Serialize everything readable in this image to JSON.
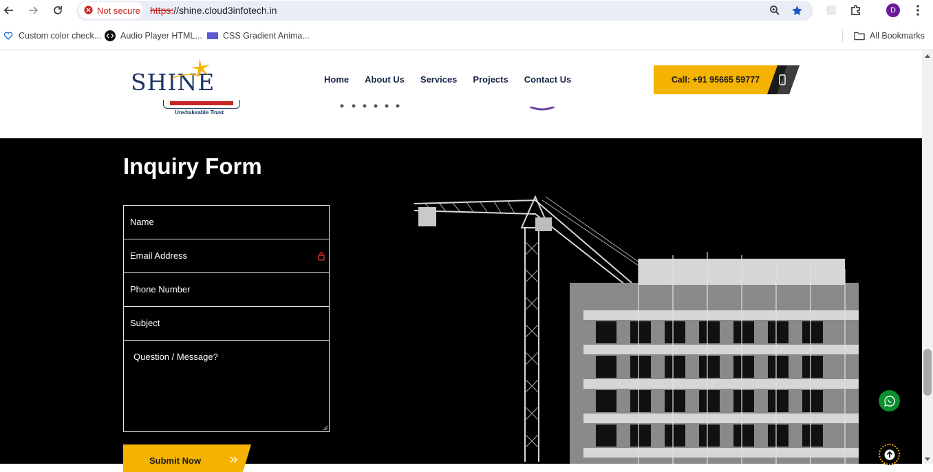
{
  "browser": {
    "security_label": "Not secure",
    "url_scheme": "https:",
    "url_rest": "//shine.cloud3infotech.in",
    "profile_initial": "D"
  },
  "bookmarks": {
    "items": [
      {
        "label": "Custom color check...",
        "icon": "heart-outline-icon"
      },
      {
        "label": "Audio Player HTML...",
        "icon": "code-icon"
      },
      {
        "label": "CSS Gradient Anima...",
        "icon": "gradient-icon"
      }
    ],
    "all_bookmarks": "All Bookmarks"
  },
  "header": {
    "logo_text": "SHINE",
    "nav": [
      "Home",
      "About Us",
      "Services",
      "Projects",
      "Contact Us"
    ],
    "call_label": "Call: +91 95665 59777"
  },
  "partners": {
    "tagline": "Unshakeable Trust"
  },
  "inquiry": {
    "title": "Inquiry Form",
    "name_placeholder": "Name",
    "email_placeholder": "Email Address",
    "phone_placeholder": "Phone Number",
    "subject_placeholder": "Subject",
    "message_placeholder": "Question / Message?",
    "submit_label": "Submit Now"
  },
  "colors": {
    "accent": "#f5b301",
    "navy": "#17244a",
    "whatsapp": "#0a8f2e"
  }
}
